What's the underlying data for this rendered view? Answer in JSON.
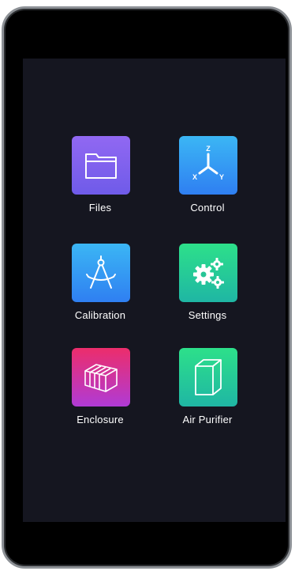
{
  "launcher": {
    "tiles": [
      {
        "label": "Files",
        "icon": "folder-icon",
        "color": "#7d61ee"
      },
      {
        "label": "Control",
        "icon": "xyz-axis-icon",
        "color": "#35a0f3",
        "axis_labels": [
          "Z",
          "X",
          "Y"
        ]
      },
      {
        "label": "Calibration",
        "icon": "compass-icon",
        "color": "#35a0f3"
      },
      {
        "label": "Settings",
        "icon": "gears-icon",
        "color": "#28cd94"
      },
      {
        "label": "Enclosure",
        "icon": "enclosure-box-icon",
        "color": "#d8345f"
      },
      {
        "label": "Air Purifier",
        "icon": "purifier-box-icon",
        "color": "#28cd94"
      }
    ]
  }
}
